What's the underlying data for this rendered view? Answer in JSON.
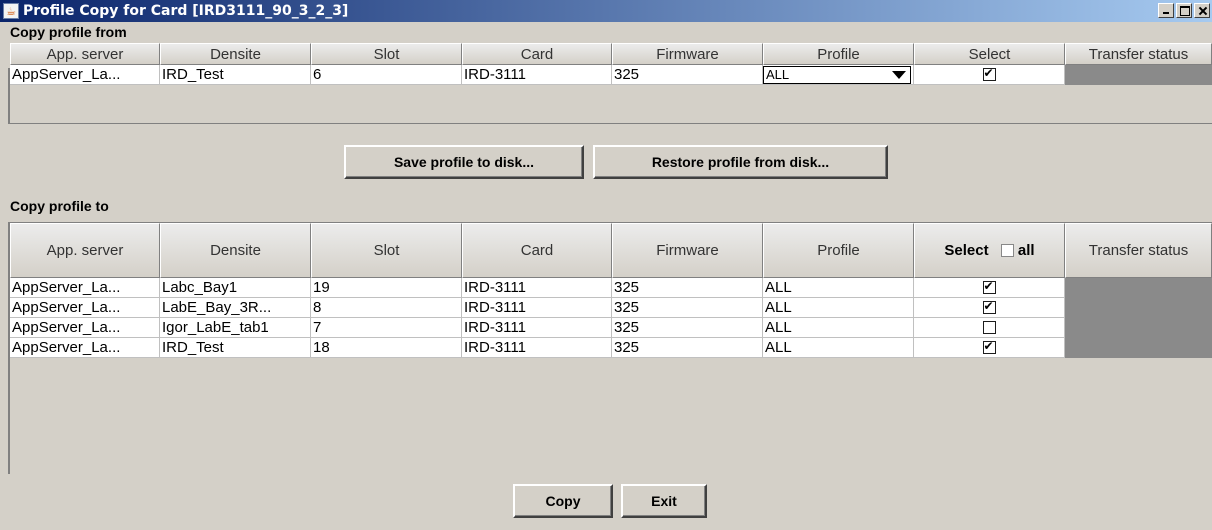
{
  "window": {
    "title": "Profile Copy for Card [IRD3111_90_3_2_3]"
  },
  "copy_from": {
    "label": "Copy profile from",
    "headers": [
      "App. server",
      "Densite",
      "Slot",
      "Card",
      "Firmware",
      "Profile",
      "Select",
      "Transfer status"
    ],
    "row": {
      "app_server": "AppServer_La...",
      "densite": "IRD_Test",
      "slot": "6",
      "card": "IRD-3111",
      "firmware": "325",
      "profile": "ALL",
      "selected": true
    }
  },
  "buttons": {
    "save": "Save profile to disk...",
    "restore": "Restore profile from disk...",
    "copy": "Copy",
    "exit": "Exit"
  },
  "copy_to": {
    "label": "Copy profile to",
    "headers": [
      "App. server",
      "Densite",
      "Slot",
      "Card",
      "Firmware",
      "Profile",
      "Select",
      "Transfer status"
    ],
    "select_all_label": "all",
    "rows": [
      {
        "app_server": "AppServer_La...",
        "densite": "Labc_Bay1",
        "slot": "19",
        "card": "IRD-3111",
        "firmware": "325",
        "profile": "ALL",
        "selected": true
      },
      {
        "app_server": "AppServer_La...",
        "densite": "LabE_Bay_3R...",
        "slot": "8",
        "card": "IRD-3111",
        "firmware": "325",
        "profile": "ALL",
        "selected": true
      },
      {
        "app_server": "AppServer_La...",
        "densite": "Igor_LabE_tab1",
        "slot": "7",
        "card": "IRD-3111",
        "firmware": "325",
        "profile": "ALL",
        "selected": false
      },
      {
        "app_server": "AppServer_La...",
        "densite": "IRD_Test",
        "slot": "18",
        "card": "IRD-3111",
        "firmware": "325",
        "profile": "ALL",
        "selected": true
      }
    ]
  },
  "colors": {
    "title_bar": "#0a246a",
    "window_bg": "#d4d0c8",
    "status_cell": "#8a8a8a"
  }
}
